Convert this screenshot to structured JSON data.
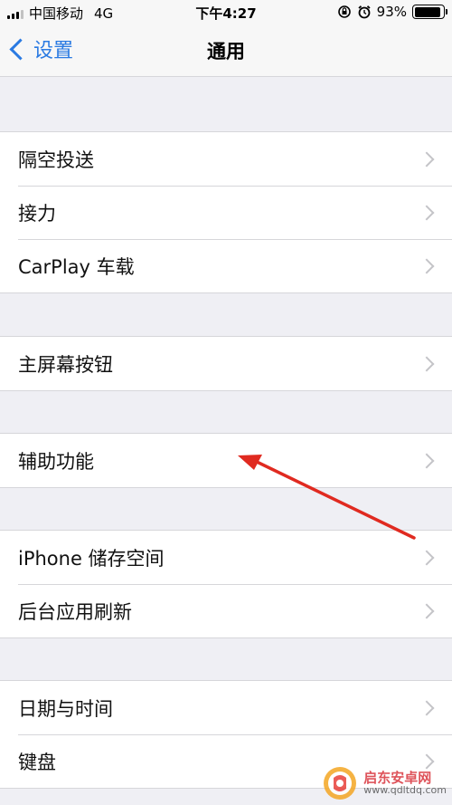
{
  "status_bar": {
    "carrier": "中国移动",
    "network": "4G",
    "time": "下午4:27",
    "battery_percent": "93%",
    "battery_level": 0.93
  },
  "nav": {
    "back_label": "设置",
    "title": "通用"
  },
  "groups": [
    {
      "items": [
        {
          "label": "隔空投送"
        },
        {
          "label": "接力"
        },
        {
          "label": "CarPlay 车载"
        }
      ]
    },
    {
      "items": [
        {
          "label": "主屏幕按钮"
        }
      ]
    },
    {
      "items": [
        {
          "label": "辅助功能"
        }
      ]
    },
    {
      "items": [
        {
          "label": "iPhone 储存空间"
        },
        {
          "label": "后台应用刷新"
        }
      ]
    },
    {
      "items": [
        {
          "label": "日期与时间"
        },
        {
          "label": "键盘"
        }
      ]
    }
  ],
  "watermark": {
    "title": "启东安卓网",
    "url": "www.qdltdq.com"
  },
  "colors": {
    "accent": "#2a7ae2",
    "annotation_arrow": "#e02a20",
    "background": "#efeff4"
  }
}
